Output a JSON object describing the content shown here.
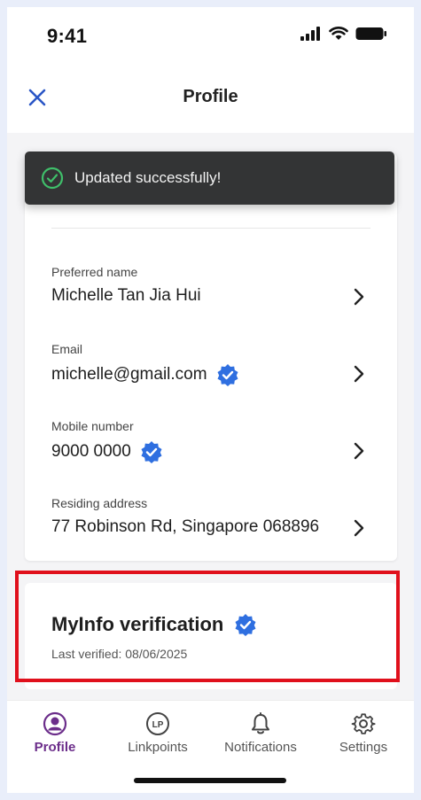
{
  "status_bar": {
    "time": "9:41"
  },
  "header": {
    "title": "Profile",
    "close_icon": "close-icon"
  },
  "toast": {
    "message": "Updated successfully!"
  },
  "profile": {
    "preferred_name": {
      "label": "Preferred name",
      "value": "Michelle Tan Jia Hui",
      "verified": false
    },
    "email": {
      "label": "Email",
      "value": "michelle@gmail.com",
      "verified": true
    },
    "mobile": {
      "label": "Mobile number",
      "value": "9000 0000",
      "verified": true
    },
    "address": {
      "label": "Residing address",
      "value": "77 Robinson Rd, Singapore 068896",
      "verified": false
    }
  },
  "myinfo": {
    "title": "MyInfo verification",
    "last_verified": "Last verified: 08/06/2025",
    "verified": true
  },
  "tabs": [
    {
      "label": "Profile",
      "icon": "profile-icon",
      "active": true
    },
    {
      "label": "Linkpoints",
      "icon": "linkpoints-icon",
      "icon_text": "LP",
      "active": false
    },
    {
      "label": "Notifications",
      "icon": "bell-icon",
      "active": false
    },
    {
      "label": "Settings",
      "icon": "gear-icon",
      "active": false
    }
  ],
  "colors": {
    "accent": "#6b2d8a",
    "verified_badge": "#2f6fe0",
    "highlight": "#e0101c",
    "toast_bg": "#333435",
    "toast_tick": "#3fbf6a"
  }
}
